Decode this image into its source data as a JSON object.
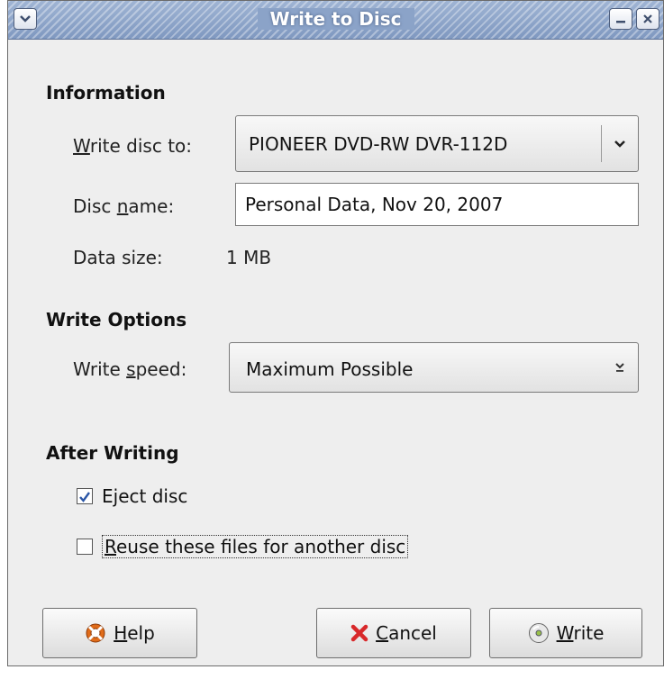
{
  "window": {
    "title": "Write to Disc"
  },
  "information": {
    "heading": "Information",
    "write_disc_to_label_pre": "",
    "write_disc_to_label_u": "W",
    "write_disc_to_label_post": "rite disc to:",
    "write_disc_to_value": "PIONEER DVD-RW DVR-112D",
    "disc_name_label_pre": "Disc ",
    "disc_name_label_u": "n",
    "disc_name_label_post": "ame:",
    "disc_name_value": "Personal Data, Nov 20, 2007",
    "data_size_label": "Data size:",
    "data_size_value": "1 MB"
  },
  "write_options": {
    "heading": "Write Options",
    "speed_label_pre": "Write ",
    "speed_label_u": "s",
    "speed_label_post": "peed:",
    "speed_value": "Maximum Possible"
  },
  "after_writing": {
    "heading": "After Writing",
    "eject_pre": "E",
    "eject_u": "j",
    "eject_post": "ect disc",
    "eject_checked": true,
    "reuse_pre": "",
    "reuse_u": "R",
    "reuse_post": "euse these files for another disc",
    "reuse_checked": false
  },
  "buttons": {
    "help_u": "H",
    "help_post": "elp",
    "cancel_u": "C",
    "cancel_post": "ancel",
    "write_u": "W",
    "write_post": "rite"
  },
  "colors": {
    "titlebar": "#8fa6c8",
    "window_bg": "#eeeeee",
    "check_mark": "#2b56a6",
    "cancel_x": "#d8282a",
    "help_ring": "#e06c1a"
  }
}
